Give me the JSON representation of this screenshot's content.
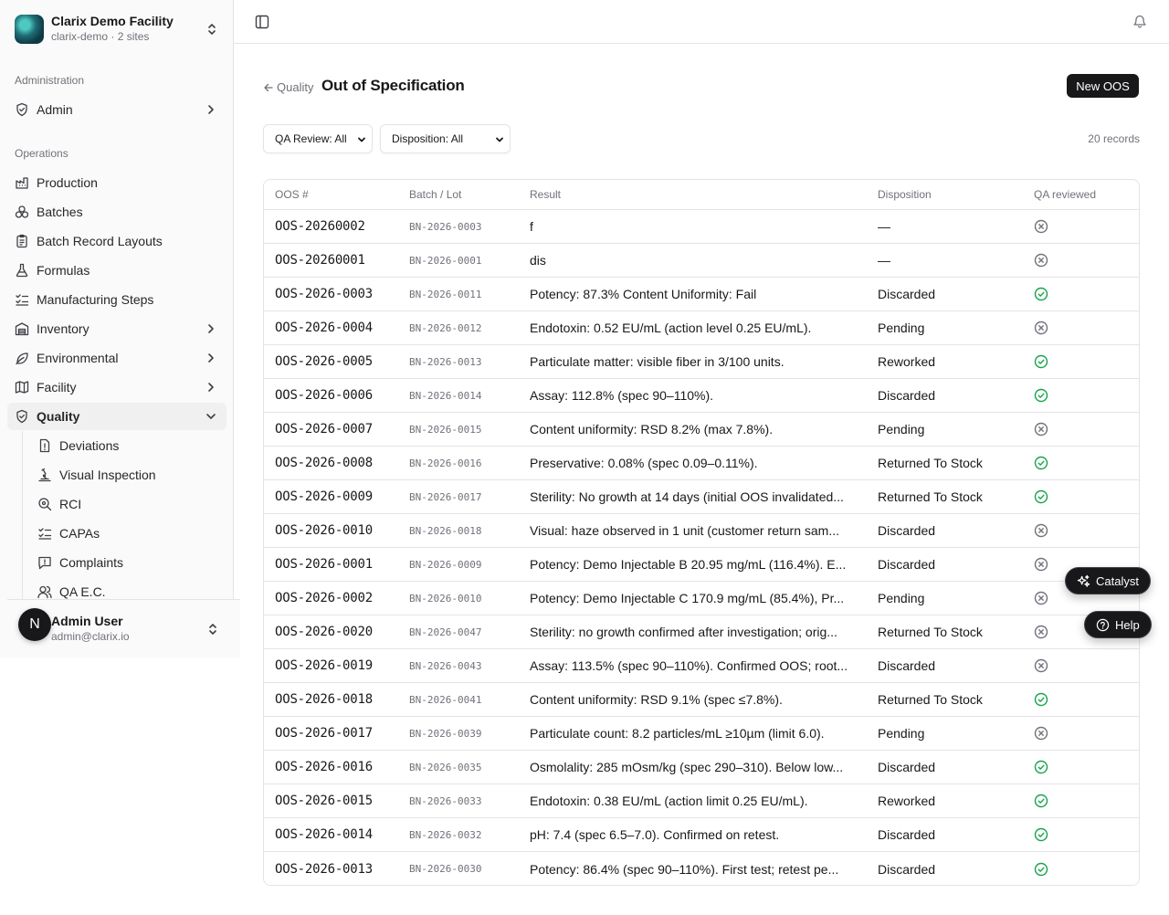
{
  "org": {
    "name": "Clarix Demo Facility",
    "slug": "clarix-demo",
    "sites": "2 sites",
    "separator": " · "
  },
  "nav": {
    "administration_label": "Administration",
    "admin": "Admin",
    "operations_label": "Operations",
    "items": [
      "Production",
      "Batches",
      "Batch Record Layouts",
      "Formulas",
      "Manufacturing Steps",
      "Inventory",
      "Environmental",
      "Facility",
      "Quality"
    ],
    "quality_sub": [
      "Deviations",
      "Visual Inspection",
      "RCI",
      "CAPAs",
      "Complaints",
      "QA E.C."
    ]
  },
  "user": {
    "initial": "N",
    "name": "Admin User",
    "email": "admin@clarix.io"
  },
  "page": {
    "back_label": "Quality",
    "title": "Out of Specification",
    "new_button": "New OOS",
    "filter_qa": "QA Review: All",
    "filter_disposition": "Disposition: All",
    "record_count": "20 records"
  },
  "table": {
    "headers": [
      "OOS #",
      "Batch / Lot",
      "Result",
      "Disposition",
      "QA reviewed"
    ],
    "rows": [
      {
        "id": "OOS-20260002",
        "batch": "BN-2026-0003",
        "result": "f",
        "disposition": "—",
        "qa": false
      },
      {
        "id": "OOS-20260001",
        "batch": "BN-2026-0001",
        "result": "dis",
        "disposition": "—",
        "qa": false
      },
      {
        "id": "OOS-2026-0003",
        "batch": "BN-2026-0011",
        "result": "Potency: 87.3% Content Uniformity: Fail",
        "disposition": "Discarded",
        "qa": true
      },
      {
        "id": "OOS-2026-0004",
        "batch": "BN-2026-0012",
        "result": "Endotoxin: 0.52 EU/mL (action level 0.25 EU/mL).",
        "disposition": "Pending",
        "qa": false
      },
      {
        "id": "OOS-2026-0005",
        "batch": "BN-2026-0013",
        "result": "Particulate matter: visible fiber in 3/100 units.",
        "disposition": "Reworked",
        "qa": true
      },
      {
        "id": "OOS-2026-0006",
        "batch": "BN-2026-0014",
        "result": "Assay: 112.8% (spec 90–110%).",
        "disposition": "Discarded",
        "qa": true
      },
      {
        "id": "OOS-2026-0007",
        "batch": "BN-2026-0015",
        "result": "Content uniformity: RSD 8.2% (max 7.8%).",
        "disposition": "Pending",
        "qa": false
      },
      {
        "id": "OOS-2026-0008",
        "batch": "BN-2026-0016",
        "result": "Preservative: 0.08% (spec 0.09–0.11%).",
        "disposition": "Returned To Stock",
        "qa": true
      },
      {
        "id": "OOS-2026-0009",
        "batch": "BN-2026-0017",
        "result": "Sterility: No growth at 14 days (initial OOS invalidated...",
        "disposition": "Returned To Stock",
        "qa": true
      },
      {
        "id": "OOS-2026-0010",
        "batch": "BN-2026-0018",
        "result": "Visual: haze observed in 1 unit (customer return sam...",
        "disposition": "Discarded",
        "qa": false
      },
      {
        "id": "OOS-2026-0001",
        "batch": "BN-2026-0009",
        "result": "Potency: Demo Injectable B 20.95 mg/mL (116.4%). E...",
        "disposition": "Discarded",
        "qa": false
      },
      {
        "id": "OOS-2026-0002",
        "batch": "BN-2026-0010",
        "result": "Potency: Demo Injectable C 170.9 mg/mL (85.4%), Pr...",
        "disposition": "Pending",
        "qa": false
      },
      {
        "id": "OOS-2026-0020",
        "batch": "BN-2026-0047",
        "result": "Sterility: no growth confirmed after investigation; orig...",
        "disposition": "Returned To Stock",
        "qa": false
      },
      {
        "id": "OOS-2026-0019",
        "batch": "BN-2026-0043",
        "result": "Assay: 113.5% (spec 90–110%). Confirmed OOS; root...",
        "disposition": "Discarded",
        "qa": false
      },
      {
        "id": "OOS-2026-0018",
        "batch": "BN-2026-0041",
        "result": "Content uniformity: RSD 9.1% (spec ≤7.8%).",
        "disposition": "Returned To Stock",
        "qa": true
      },
      {
        "id": "OOS-2026-0017",
        "batch": "BN-2026-0039",
        "result": "Particulate count: 8.2 particles/mL ≥10µm (limit 6.0).",
        "disposition": "Pending",
        "qa": false
      },
      {
        "id": "OOS-2026-0016",
        "batch": "BN-2026-0035",
        "result": "Osmolality: 285 mOsm/kg (spec 290–310). Below low...",
        "disposition": "Discarded",
        "qa": true
      },
      {
        "id": "OOS-2026-0015",
        "batch": "BN-2026-0033",
        "result": "Endotoxin: 0.38 EU/mL (action limit 0.25 EU/mL).",
        "disposition": "Reworked",
        "qa": true
      },
      {
        "id": "OOS-2026-0014",
        "batch": "BN-2026-0032",
        "result": "pH: 7.4 (spec 6.5–7.0). Confirmed on retest.",
        "disposition": "Discarded",
        "qa": true
      },
      {
        "id": "OOS-2026-0013",
        "batch": "BN-2026-0030",
        "result": "Potency: 86.4% (spec 90–110%). First test; retest pe...",
        "disposition": "Discarded",
        "qa": true
      }
    ]
  },
  "floating": {
    "catalyst": "Catalyst",
    "help": "Help"
  },
  "colors": {
    "accent": "#18181b",
    "qa_yes": "#16a34a",
    "qa_no": "#71717a",
    "border": "#e4e4e7"
  }
}
